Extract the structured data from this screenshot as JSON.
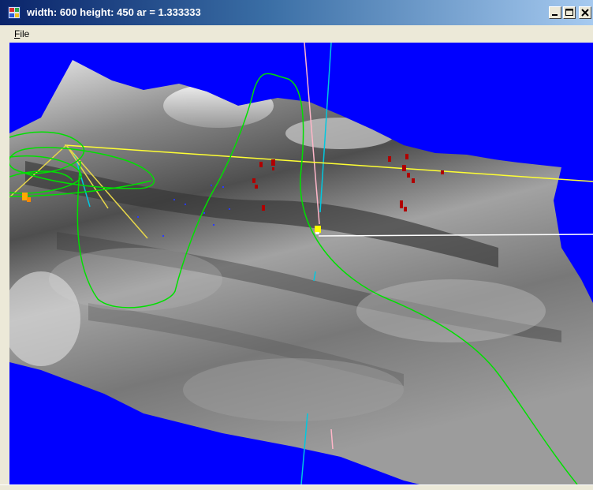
{
  "window": {
    "title": "width: 600 height: 450  ar = 1.333333",
    "app_icon": "window-app-icon",
    "controls": [
      "minimize-icon",
      "maximize-icon",
      "close-icon"
    ]
  },
  "menu": {
    "file_mnemonic": "F",
    "file_rest": "ile"
  },
  "viewport": {
    "background_color": "#0000ff",
    "terrain_color": "#8f8f8f",
    "path_color": "#00e000",
    "marker_color": "#ffff00",
    "point_color": "#b00000"
  },
  "colors": {
    "titlebar_start": "#0a246a",
    "titlebar_end": "#a6caf0",
    "window_face": "#ece9d8",
    "yellow_line": "#ffff33",
    "cyan_line": "#00c8e0",
    "pink_line": "#ffb6c8",
    "white_line": "#ffffff"
  }
}
